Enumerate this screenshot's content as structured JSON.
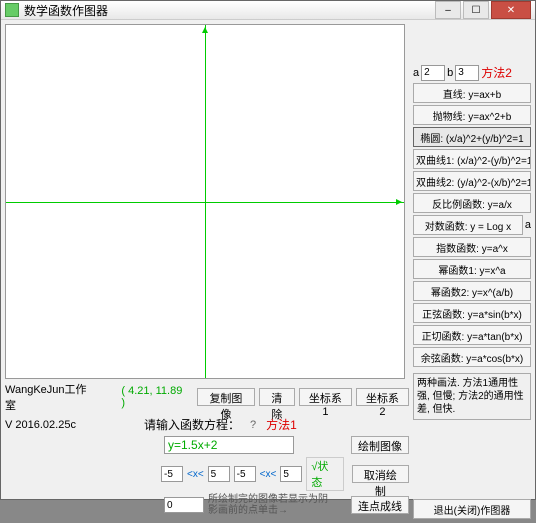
{
  "window": {
    "title": "数学函数作图器"
  },
  "studio": {
    "name": "WangKeJun工作室",
    "version": "V 2016.02.25c",
    "coords": "( 4.21, 11.89 )"
  },
  "toolbar": {
    "copy_image": "复制图像",
    "clear": "清除",
    "coord1": "坐标系1",
    "coord2": "坐标系2"
  },
  "equation": {
    "prompt": "请输入函数方程：",
    "qmark": "?",
    "method1": "方法1",
    "value": "y=1.5x+2",
    "draw": "绘制图像"
  },
  "range": {
    "x1_lo": "-5",
    "x1_hi": "5",
    "x2_lo": "-5",
    "x2_hi": "5",
    "op": "<x<",
    "status": "√状态",
    "cancel": "取消绘制",
    "hint": "所绘制完的图像若显示为阴影画前的点单击→",
    "zero": "0",
    "connect": "连点成线"
  },
  "params": {
    "a_label": "a",
    "a_val": "2",
    "b_label": "b",
    "b_val": "3",
    "method2": "方法2"
  },
  "fns": {
    "line": "直线: y=ax+b",
    "parabola": "抛物线: y=ax^2+b",
    "ellipse": "椭圆: (x/a)^2+(y/b)^2=1",
    "hyp1": "双曲线1: (x/a)^2-(y/b)^2=1",
    "hyp2": "双曲线2: (y/a)^2-(x/b)^2=1",
    "inverse": "反比例函数: y=a/x",
    "log": "对数函数: y = Log x",
    "log_base": "a",
    "exp": "指数函数: y=a^x",
    "pow1": "幂函数1: y=x^a",
    "pow2": "幂函数2: y=x^(a/b)",
    "sin": "正弦函数: y=a*sin(b*x)",
    "tan": "正切函数: y=a*tan(b*x)",
    "cos": "余弦函数: y=a*cos(b*x)"
  },
  "note": "两种画法. 方法1通用性强, 但慢; 方法2的通用性差, 但快.",
  "exit": "退出(关闭)作图器"
}
